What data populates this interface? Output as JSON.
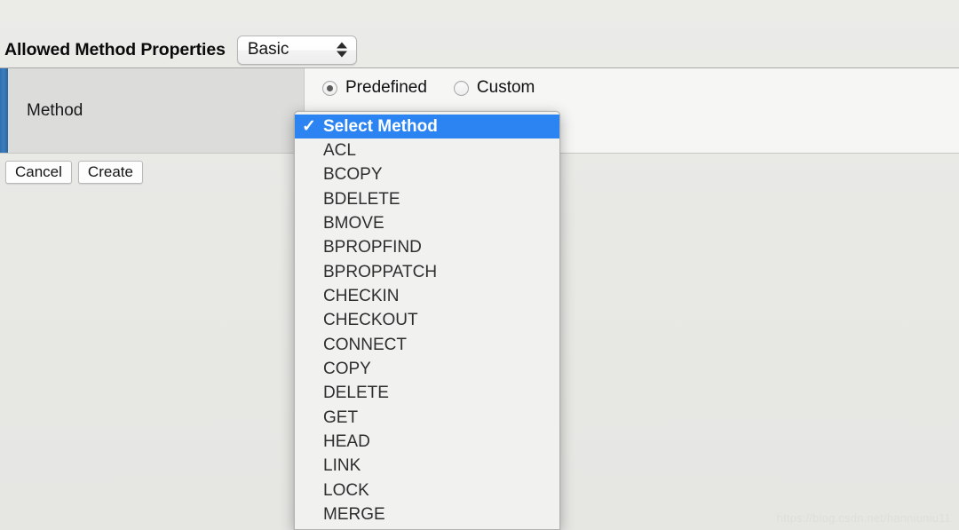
{
  "section": {
    "title": "Allowed Method Properties"
  },
  "scheme_select": {
    "value": "Basic",
    "stepper_up_icon": "triangle-up-icon",
    "stepper_down_icon": "triangle-down-icon"
  },
  "form_row": {
    "field_label": "Method",
    "radios": [
      {
        "label": "Predefined",
        "selected": true
      },
      {
        "label": "Custom",
        "selected": false
      }
    ]
  },
  "actions": {
    "cancel_label": "Cancel",
    "create_label": "Create"
  },
  "dropdown": {
    "open": true,
    "check_icon": "checkmark-icon",
    "selected_index": 0,
    "items": [
      "Select Method",
      "ACL",
      "BCOPY",
      "BDELETE",
      "BMOVE",
      "BPROPFIND",
      "BPROPPATCH",
      "CHECKIN",
      "CHECKOUT",
      "CONNECT",
      "COPY",
      "DELETE",
      "GET",
      "HEAD",
      "LINK",
      "LOCK",
      "MERGE"
    ]
  },
  "watermark": {
    "text": "https://blog.csdn.net/hanniuniu11"
  },
  "colors": {
    "highlight": "#2b84f2",
    "row_accent": "#3b7dbe",
    "panel_bg": "#f6f6f5",
    "page_bg": "#e9e9e6",
    "menu_bg": "#f1f1f0"
  }
}
